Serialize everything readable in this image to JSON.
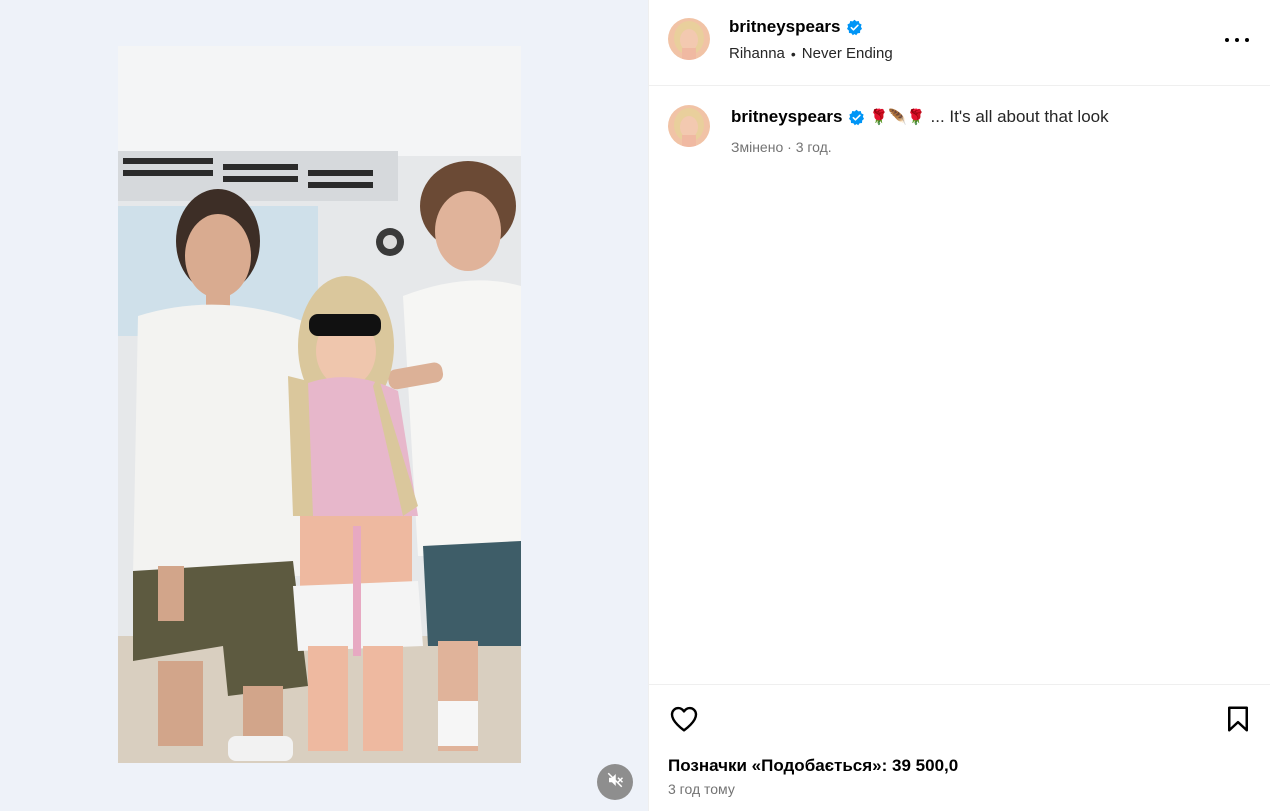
{
  "post": {
    "username": "britneyspears",
    "verified": true,
    "audio_artist": "Rihanna",
    "audio_separator": "•",
    "audio_track": "Never Ending"
  },
  "caption": {
    "username": "britneyspears",
    "emojis": "🌹🪶🌹",
    "text": "... It's all about that look",
    "edited_label": "Змінено",
    "meta_separator": "·",
    "time": "3 год."
  },
  "actions": {
    "likes_text": "Позначки «Подобається»: 39 500,0",
    "time_ago": "3 год тому"
  },
  "colors": {
    "verified_badge": "#0095f6",
    "media_background": "#eef2f9",
    "secondary_text": "#737373"
  },
  "icons": {
    "like": "heart-outline-icon",
    "save": "bookmark-outline-icon",
    "more": "ellipsis-icon",
    "mute": "speaker-muted-icon",
    "verified": "verified-badge-icon"
  }
}
